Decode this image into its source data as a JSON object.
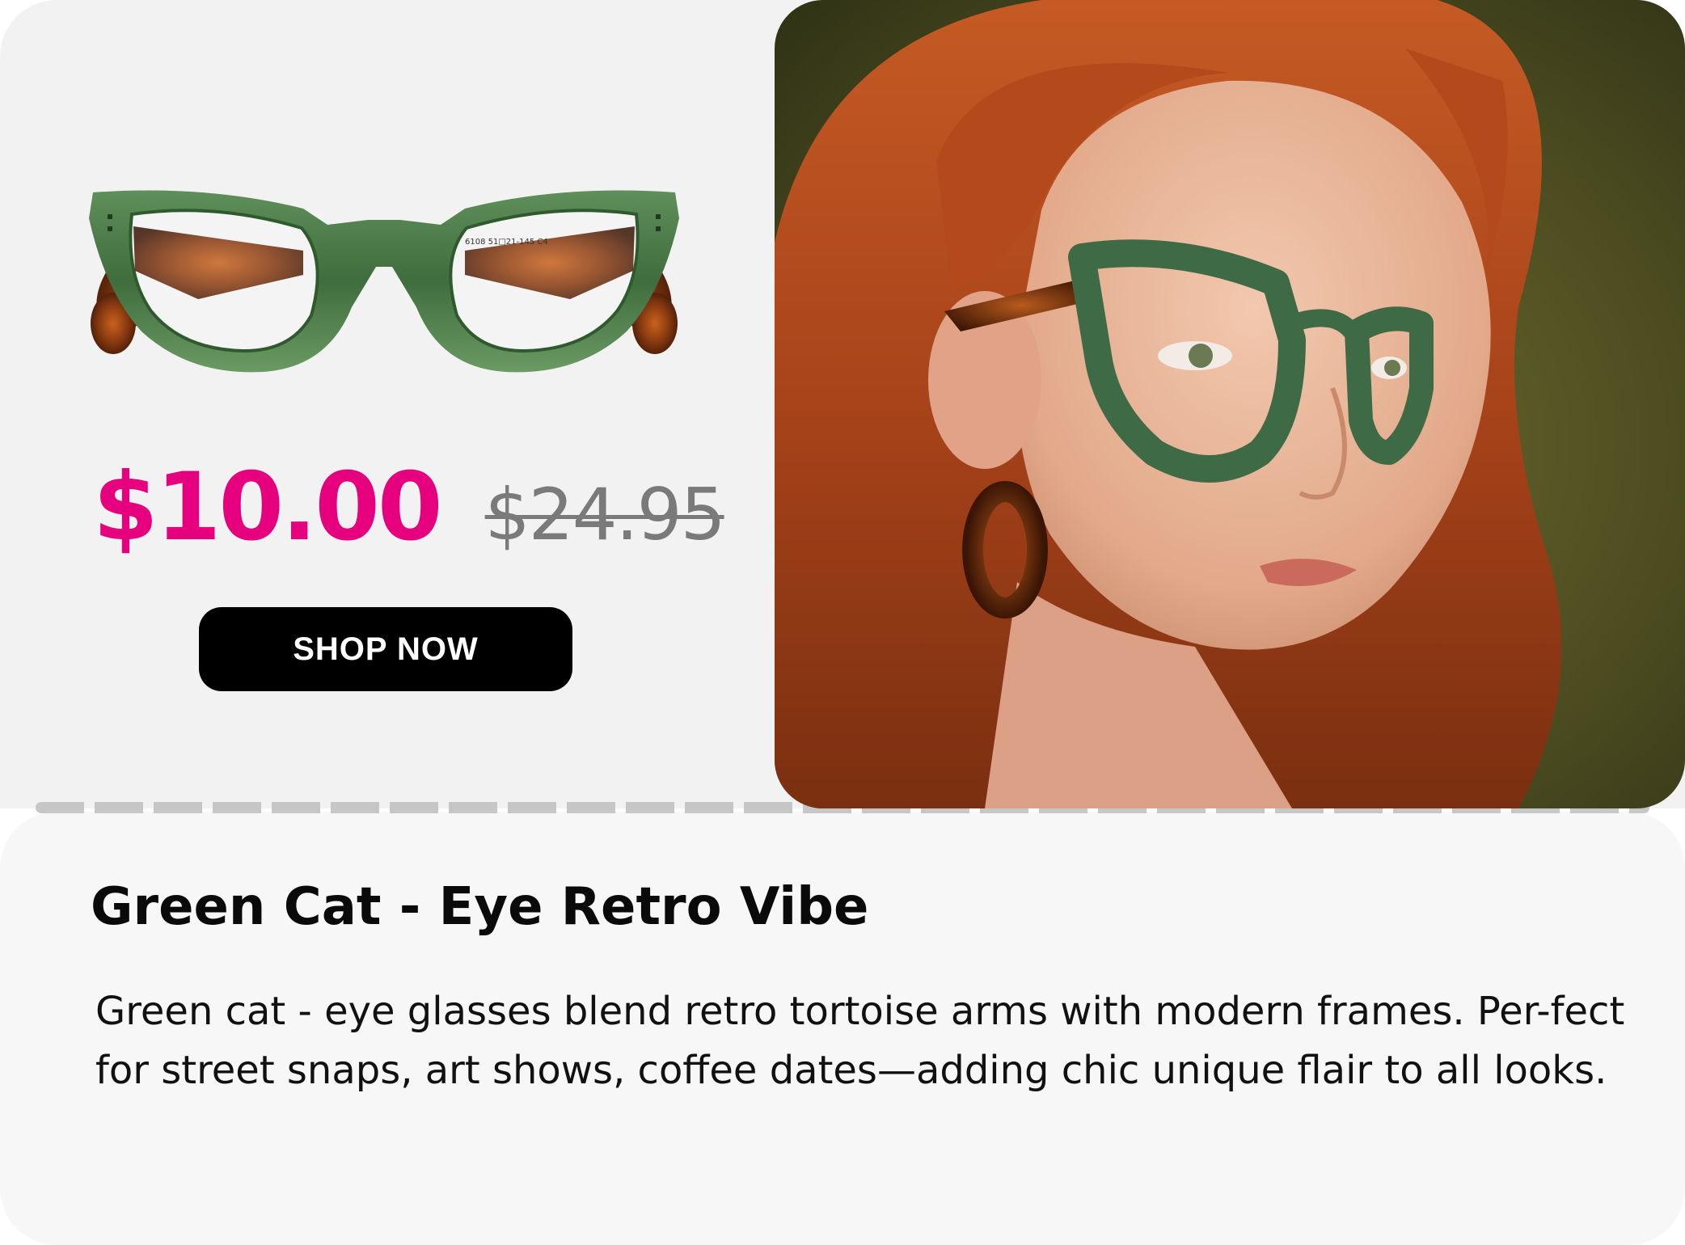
{
  "product": {
    "title": "Green Cat - Eye Retro Vibe",
    "description": "Green cat - eye glasses blend retro tortoise arms with modern frames. Per-fect for street snaps, art shows, coffee dates—adding chic unique flair to all looks.",
    "price_current": "$10.00",
    "price_original": "$24.95",
    "frame_imprint": "6108 51□21-145 C4"
  },
  "cta": {
    "shop_label": "SHOP  NOW"
  },
  "colors": {
    "accent_price": "#e6007e",
    "button_bg": "#000000",
    "frame_green": "#4d7a4a",
    "tortoise": "#7a3a12"
  },
  "icons": {
    "product": "glasses-product-image",
    "lifestyle": "model-wearing-glasses-photo"
  }
}
